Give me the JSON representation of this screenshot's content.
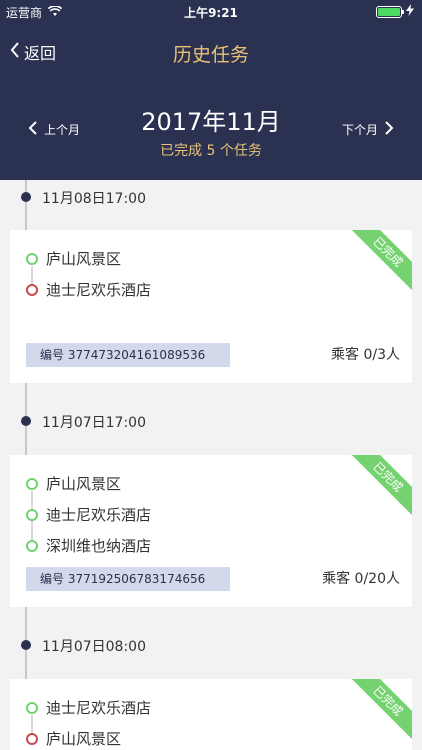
{
  "status_bar": {
    "carrier": "运营商",
    "time": "上午9:21"
  },
  "nav": {
    "back_label": "返回",
    "title": "历史任务"
  },
  "month": {
    "prev_label": "上个月",
    "next_label": "下个月",
    "title": "2017年11月",
    "subtitle": "已完成 5 个任务"
  },
  "colors": {
    "header_bg": "#2b3150",
    "accent_gold": "#e8c17a",
    "status_green": "#74d26f",
    "end_red": "#c94a4a"
  },
  "tasks": [
    {
      "time": "11月08日17:00",
      "status": "已完成",
      "stops": [
        "庐山风景区",
        "迪士尼欢乐酒店"
      ],
      "order": "编号 377473204161089536",
      "passengers": "乘客 0/3人"
    },
    {
      "time": "11月07日17:00",
      "status": "已完成",
      "stops": [
        "庐山风景区",
        "迪士尼欢乐酒店",
        "深圳维也纳酒店"
      ],
      "order": "编号 377192506783174656",
      "passengers": "乘客 0/20人"
    },
    {
      "time": "11月07日08:00",
      "status": "已完成",
      "stops": [
        "迪士尼欢乐酒店",
        "庐山风景区"
      ]
    }
  ]
}
